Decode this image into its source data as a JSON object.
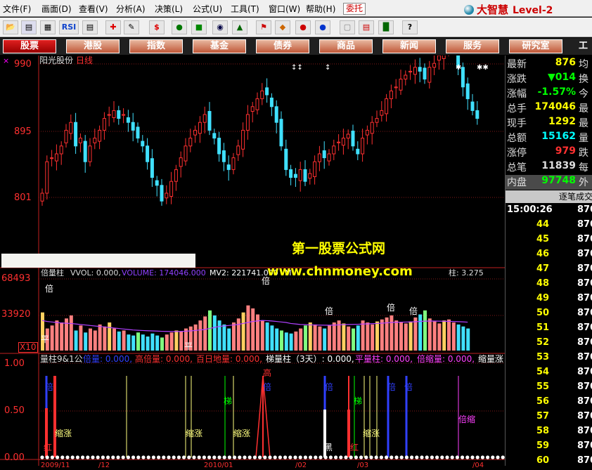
{
  "menu": {
    "items": [
      "文件(F)",
      "画面(D)",
      "查看(V)",
      "分析(A)",
      "决策(L)",
      "公式(U)",
      "工具(T)",
      "窗口(W)",
      "帮助(H)"
    ],
    "entrust": "委托",
    "brand": "大智慧",
    "level": "Level-2"
  },
  "toolbar": {
    "rsi_label": "RSI",
    "s_label": "$"
  },
  "navbar": {
    "items": [
      "股票",
      "港股",
      "指数",
      "基金",
      "债券",
      "商品",
      "新闻",
      "服务",
      "研究室"
    ],
    "partial": "工",
    "active_index": 0
  },
  "stock": {
    "name": "阳光股份",
    "period": "日线"
  },
  "price_axis": {
    "ticks": [
      "990",
      "895",
      "801"
    ]
  },
  "vol_axis": {
    "ticks": [
      "68493",
      "33920"
    ],
    "multiplier": "X10"
  },
  "vol_indicator": {
    "name": "倍量柱",
    "vvol_label": "VVOL: 0.000,",
    "volume_label": "VOLUME: 174046.000",
    "mv2_label": "MV2: 221741.000",
    "mv_label": "MV",
    "tail_label": "柱: 3.275"
  },
  "bottom_axis": {
    "ticks": [
      "1.00",
      "0.50",
      "0.00"
    ]
  },
  "bottom_indicator": {
    "name": "量柱9&1公",
    "legend": [
      "倍量: 0.000,",
      "高倍量: 0.000,",
      "百日地量: 0.000,",
      "梯量柱（3天）: 0.000,",
      "平量柱: 0.000,",
      "倍缩量: 0.000,",
      "缩量涨"
    ],
    "legend_colors": [
      "#3040ff",
      "#ff3030",
      "#ff3030",
      "#ffffff",
      "#ff40ff",
      "#ff40ff",
      "#ffffff"
    ]
  },
  "chart_labels": {
    "bei": "倍",
    "ping": "平",
    "tiliang": "梯",
    "suozhang": "缩涨",
    "gao": "高",
    "hong": "红",
    "hei": "黑",
    "beisuo": "倍缩"
  },
  "watermark": {
    "line1": "第一股票公式网",
    "line2": "www.chnmoney.com"
  },
  "date_ticks": [
    "2009/11",
    "/12",
    "2010/01",
    "/02",
    "/03",
    "/04"
  ],
  "quote": {
    "rows": [
      {
        "key": "最新",
        "value": "876",
        "color": "#ffff00",
        "extra": "均"
      },
      {
        "key": "涨跌",
        "value": "▼014",
        "color": "#00ff00",
        "extra": "换"
      },
      {
        "key": "涨幅",
        "value": "-1.57%",
        "color": "#00ff00",
        "extra": "今"
      },
      {
        "key": "总手",
        "value": "174046",
        "color": "#ffff00",
        "extra": "最"
      },
      {
        "key": "现手",
        "value": "1292",
        "color": "#ffff00",
        "extra": "最"
      },
      {
        "key": "总额",
        "value": "15162",
        "color": "#00ffff",
        "extra": "量"
      },
      {
        "key": "涨停",
        "value": "979",
        "color": "#ff3030",
        "extra": "跌"
      },
      {
        "key": "总笔",
        "value": "11839",
        "color": "#dddddd",
        "extra": "每"
      },
      {
        "key": "内盘",
        "value": "97748",
        "color": "#00ff00",
        "extra": "外"
      }
    ],
    "trades_header": "逐笔成交",
    "trades": [
      {
        "time": "15:00:26",
        "price": "870"
      },
      {
        "time": "44",
        "price": "870"
      },
      {
        "time": "45",
        "price": "870"
      },
      {
        "time": "46",
        "price": "870"
      },
      {
        "time": "47",
        "price": "870"
      },
      {
        "time": "48",
        "price": "870"
      },
      {
        "time": "49",
        "price": "870"
      },
      {
        "time": "50",
        "price": "870"
      },
      {
        "time": "51",
        "price": "870"
      },
      {
        "time": "52",
        "price": "870"
      },
      {
        "time": "53",
        "price": "870"
      },
      {
        "time": "54",
        "price": "870"
      },
      {
        "time": "55",
        "price": "870"
      },
      {
        "time": "56",
        "price": "870"
      },
      {
        "time": "57",
        "price": "870"
      },
      {
        "time": "58",
        "price": "870"
      },
      {
        "time": "59",
        "price": "870"
      },
      {
        "time": "60",
        "price": "870"
      }
    ]
  },
  "chart_data": {
    "type": "candlestick",
    "price_range": [
      750,
      1000
    ],
    "candles_close": [
      800,
      840,
      845,
      850,
      860,
      880,
      890,
      860,
      870,
      840,
      860,
      870,
      880,
      895,
      900,
      905,
      895,
      900,
      890,
      880,
      870,
      860,
      840,
      820,
      810,
      790,
      800,
      815,
      830,
      845,
      860,
      870,
      880,
      890,
      900,
      880,
      870,
      850,
      840,
      830,
      845,
      860,
      880,
      900,
      910,
      920,
      930,
      925,
      910,
      890,
      860,
      830,
      820,
      820,
      830,
      815,
      825,
      840,
      850,
      845,
      850,
      860,
      865,
      870,
      875,
      860,
      850,
      870,
      880,
      890,
      895,
      905,
      920,
      930,
      935,
      945,
      950,
      955,
      960,
      955,
      945,
      960,
      965,
      975,
      980,
      985,
      990,
      960,
      935,
      920,
      905,
      895
    ],
    "volume_range": [
      0,
      70000
    ],
    "volume": [
      38000,
      22000,
      25000,
      30000,
      28000,
      32000,
      35000,
      20000,
      25000,
      18000,
      22000,
      20000,
      26000,
      24000,
      28000,
      22000,
      19000,
      20000,
      16000,
      15000,
      18000,
      16000,
      14000,
      17000,
      15000,
      13000,
      16000,
      18000,
      20000,
      19000,
      22000,
      24000,
      26000,
      30000,
      34000,
      40000,
      35000,
      30000,
      26000,
      22000,
      28000,
      32000,
      38000,
      45000,
      42000,
      36000,
      30000,
      28000,
      25000,
      22000,
      20000,
      18000,
      17000,
      19000,
      22000,
      25000,
      28000,
      26000,
      24000,
      22000,
      25000,
      28000,
      30000,
      27000,
      24000,
      22000,
      25000,
      30000,
      28000,
      26000,
      29000,
      31000,
      33000,
      35000,
      30000,
      28000,
      27000,
      29000,
      33000,
      36000,
      40000,
      32000,
      29000,
      27000,
      30000,
      31000,
      28000,
      26000,
      24000,
      22000
    ],
    "ma_volume": [
      30000,
      29000,
      28500,
      28000,
      27500,
      27200,
      27000,
      26500,
      26000,
      25500,
      25000,
      24500,
      24000,
      23500,
      23000,
      22500,
      22000,
      21500,
      21000,
      20500,
      20200,
      20000,
      19800,
      19600,
      19400,
      19200,
      19100,
      19000,
      19000,
      19100,
      19300,
      19600,
      20000,
      20500,
      21000,
      22000,
      23000,
      24000,
      24500,
      25000,
      25500,
      26000,
      27000,
      28000,
      29000,
      29500,
      30000,
      29800,
      29500,
      29000,
      28500,
      28000,
      27000,
      26500,
      26000,
      25800,
      25600,
      25500,
      25400,
      25300,
      25300,
      25400,
      25600,
      25800,
      26000,
      26100,
      26200,
      26400,
      26600,
      26800,
      27000,
      27300,
      27600,
      28000,
      28200,
      28300,
      28400,
      28500,
      28700,
      29000,
      29300,
      29400,
      29400,
      29300,
      29200,
      29100,
      29000,
      28800,
      28600,
      28300
    ]
  }
}
